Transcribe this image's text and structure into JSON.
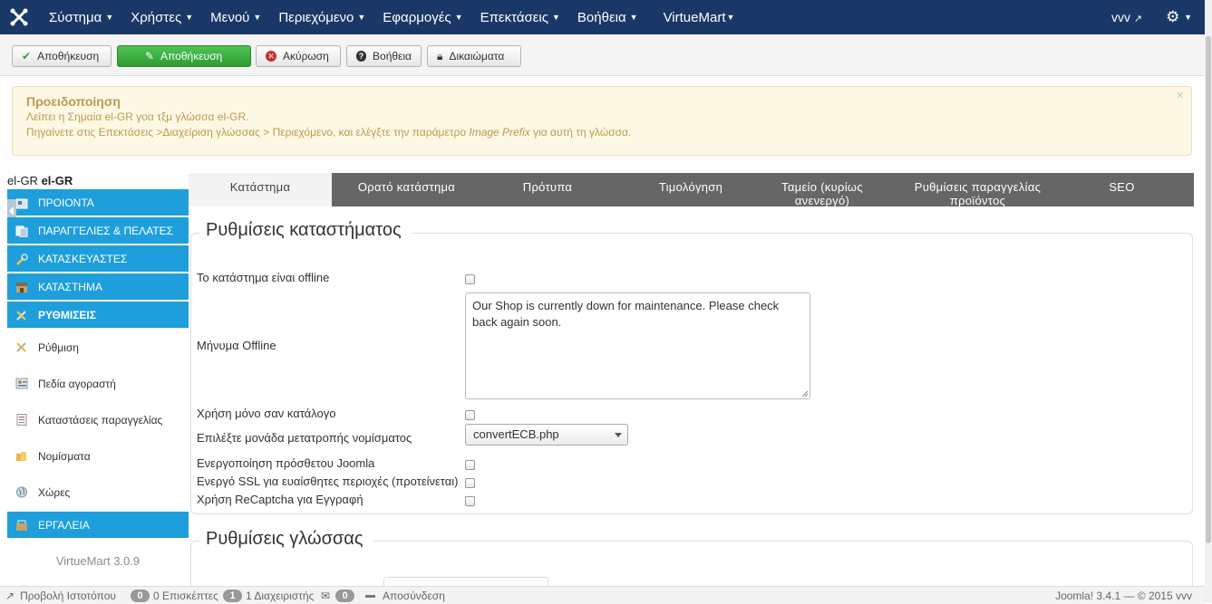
{
  "navbar": {
    "menu": [
      {
        "label": "Σύστημα"
      },
      {
        "label": "Χρήστες"
      },
      {
        "label": "Μενού"
      },
      {
        "label": "Περιεχόμενο"
      },
      {
        "label": "Εφαρμογές"
      },
      {
        "label": "Επεκτάσεις"
      },
      {
        "label": "Βοήθεια"
      },
      {
        "label": "VirtueMart"
      }
    ],
    "user": "vvv",
    "colors": {
      "background": "#1a3867"
    }
  },
  "toolbar": {
    "save": "Αποθήκευση",
    "save_primary": "Αποθήκευση",
    "cancel": "Ακύρωση",
    "help": "Βοήθεια",
    "permissions": "Δικαιώματα"
  },
  "alert": {
    "title": "Προειδοποίηση",
    "line1": "Λείπει η Σημαία el-GR γοα τξμ γλώσσα el-GR.",
    "line2_prefix": "Πηγαίνετε στις Επεκτάσεις >Διαχείριση γλώσσας > Περιεχόμενο, και ελέγξτε την παράμετρο ",
    "line2_em": "Image Prefix",
    "line2_suffix": " για αυτή τη γλώσσα.",
    "close": "×"
  },
  "sidebar": {
    "lang_prefix": "el-GR",
    "lang_bold": "el-GR",
    "sections": [
      {
        "label": "ΠΡΟΙΟΝΤΑ",
        "icon": "products-icon"
      },
      {
        "label": "ΠΑΡΑΓΓΕΛΙΕΣ & ΠΕΛΑΤΕΣ",
        "icon": "orders-icon"
      },
      {
        "label": "ΚΑΤΑΣΚΕΥΑΣΤΕΣ",
        "icon": "wrench-icon"
      },
      {
        "label": "ΚΑΤΑΣΤΗΜΑ",
        "icon": "shop-icon"
      },
      {
        "label": "ΡΥΘΜΙΣΕΙΣ",
        "icon": "settings-icon"
      }
    ],
    "sub_items": [
      {
        "label": "Ρύθμιση",
        "icon": "config-icon"
      },
      {
        "label": "Πεδία αγοραστή",
        "icon": "userfields-icon"
      },
      {
        "label": "Καταστάσεις παραγγελίας",
        "icon": "orderstatus-icon"
      },
      {
        "label": "Νομίσματα",
        "icon": "currency-icon"
      },
      {
        "label": "Χώρες",
        "icon": "globe-icon"
      }
    ],
    "tools": {
      "label": "ΕΡΓΑΛΕΙΑ",
      "icon": "tools-icon"
    },
    "version": "VirtueMart 3.0.9",
    "colors": {
      "section": "#1e9fdc"
    }
  },
  "tabs": [
    "Κατάστημα",
    "Ορατό κατάστημα",
    "Πρότυπα",
    "Τιμολόγηση",
    "Ταμείο (κυρίως ανενεργό)",
    "Ρυθμίσεις παραγγελίας προϊόντος",
    "SEO"
  ],
  "shop_settings": {
    "legend": "Ρυθμίσεις καταστήματος",
    "offline_label": "Το κατάστημα είναι offline",
    "offline_message_label": "Μήνυμα Offline",
    "offline_message": "Our Shop is currently down for maintenance. Please check back again soon.",
    "catalog_label": "Χρήση μόνο σαν κατάλογο",
    "currency_module_label": "Επιλέξτε μονάδα μετατροπής νομίσματος",
    "currency_module_value": "convertECB.php",
    "joomla_plugin_label": "Ενεργοποίηση πρόσθετου Joomla",
    "ssl_label": "Ενεργό SSL για ευαίσθητες περιοχές (προτείνεται)",
    "recaptcha_label": "Χρήση ReCaptcha για Εγγραφή"
  },
  "language_settings": {
    "legend": "Ρυθμίσεις γλώσσας"
  },
  "statusbar": {
    "view_site": "Προβολή Ιστοτόπου",
    "visitors_count": "0",
    "visitors_label": "0 Επισκέπτες",
    "admins_count": "1",
    "admins_label": "1 Διαχειριστής",
    "messages_count": "0",
    "logout": "Αποσύνδεση",
    "version": "Joomla! 3.4.1 — © 2015 vvv"
  }
}
